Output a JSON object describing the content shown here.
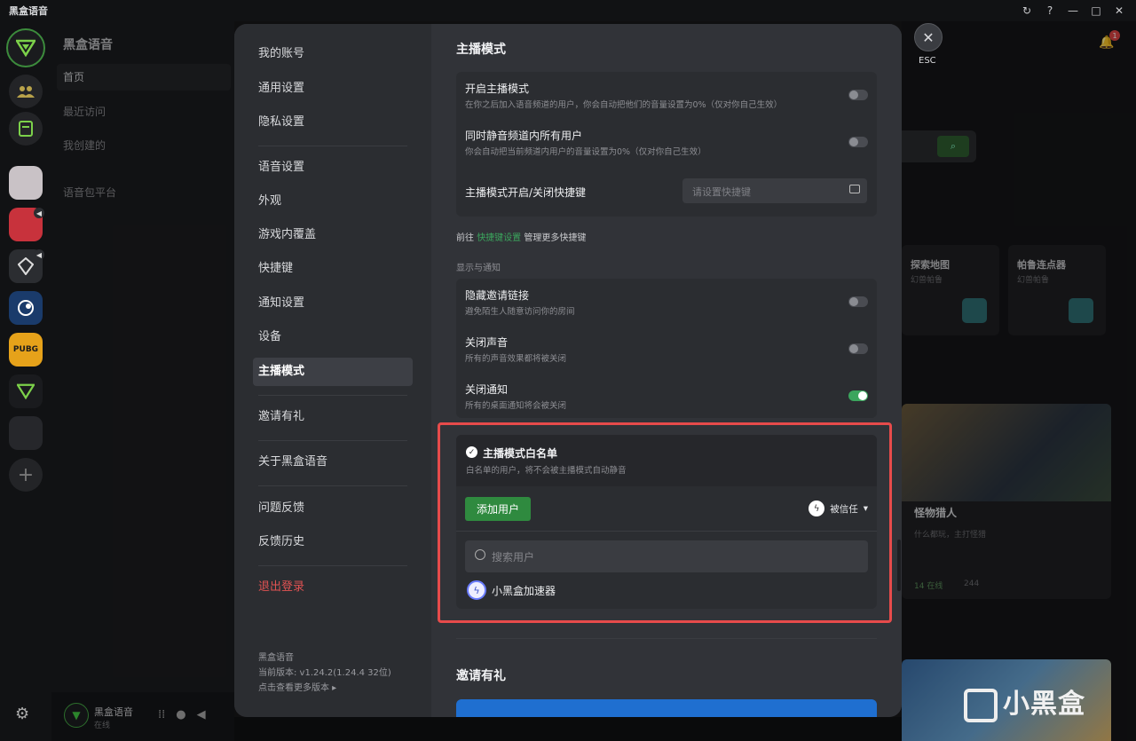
{
  "app": {
    "title": "黑盒语音"
  },
  "window_controls": [
    "↻",
    "?",
    "—",
    "□",
    "✕"
  ],
  "channel_list": {
    "title": "黑盒语音",
    "items": [
      "首页",
      "最近访问",
      "我创建的",
      "语音包平台"
    ]
  },
  "user": {
    "name": "黑盒语音",
    "status": "在线"
  },
  "bg": {
    "cards": [
      {
        "title": "探索地图",
        "sub": "幻兽帕鲁"
      },
      {
        "title": "帕鲁连点器",
        "sub": "幻兽帕鲁"
      }
    ],
    "game": {
      "title": "怪物猎人",
      "sub": "什么都玩，主打怪猎",
      "online": "14 在线",
      "count": "244"
    },
    "watermark": "小黑盒",
    "notif_badge": "1"
  },
  "settings_nav": {
    "items": [
      "我的账号",
      "通用设置",
      "隐私设置",
      "语音设置",
      "外观",
      "游戏内覆盖",
      "快捷键",
      "通知设置",
      "设备",
      "主播模式",
      "邀请有礼",
      "关于黑盒语音",
      "问题反馈",
      "反馈历史"
    ],
    "selected": "主播模式",
    "logout": "退出登录",
    "version_title": "黑盒语音",
    "version": "当前版本: v1.24.2(1.24.4 32位)",
    "version_link": "点击查看更多版本 ▸"
  },
  "streamer": {
    "title": "主播模式",
    "rows": [
      {
        "title": "开启主播模式",
        "sub": "在你之后加入语音频道的用户，你会自动把他们的音量设置为0%（仅对你自己生效）",
        "on": false
      },
      {
        "title": "同时静音频道内所有用户",
        "sub": "你会自动把当前频道内用户的音量设置为0%（仅对你自己生效）",
        "on": false
      }
    ],
    "hotkey_label": "主播模式开启/关闭快捷键",
    "hotkey_placeholder": "请设置快捷键",
    "link_prefix": "前往",
    "link_text": "快捷键设置",
    "link_suffix": "管理更多快捷键",
    "display_section": "显示与通知",
    "display_rows": [
      {
        "title": "隐藏邀请链接",
        "sub": "避免陌生人随意访问你的房间",
        "on": false
      },
      {
        "title": "关闭声音",
        "sub": "所有的声音效果都将被关闭",
        "on": false
      },
      {
        "title": "关闭通知",
        "sub": "所有的桌面通知将会被关闭",
        "on": true
      }
    ],
    "whitelist": {
      "title": "主播模式白名单",
      "sub": "白名单的用户，将不会被主播模式自动静音",
      "add_button": "添加用户",
      "trust_label": "被信任",
      "search_placeholder": "搜索用户",
      "users": [
        "小黑盒加速器"
      ]
    },
    "invite_title": "邀请有礼"
  },
  "esc": {
    "label": "ESC"
  },
  "colors": {
    "accent_green": "#3ba55d",
    "highlight_red": "#e74b4b",
    "logout_red": "#e05252"
  }
}
